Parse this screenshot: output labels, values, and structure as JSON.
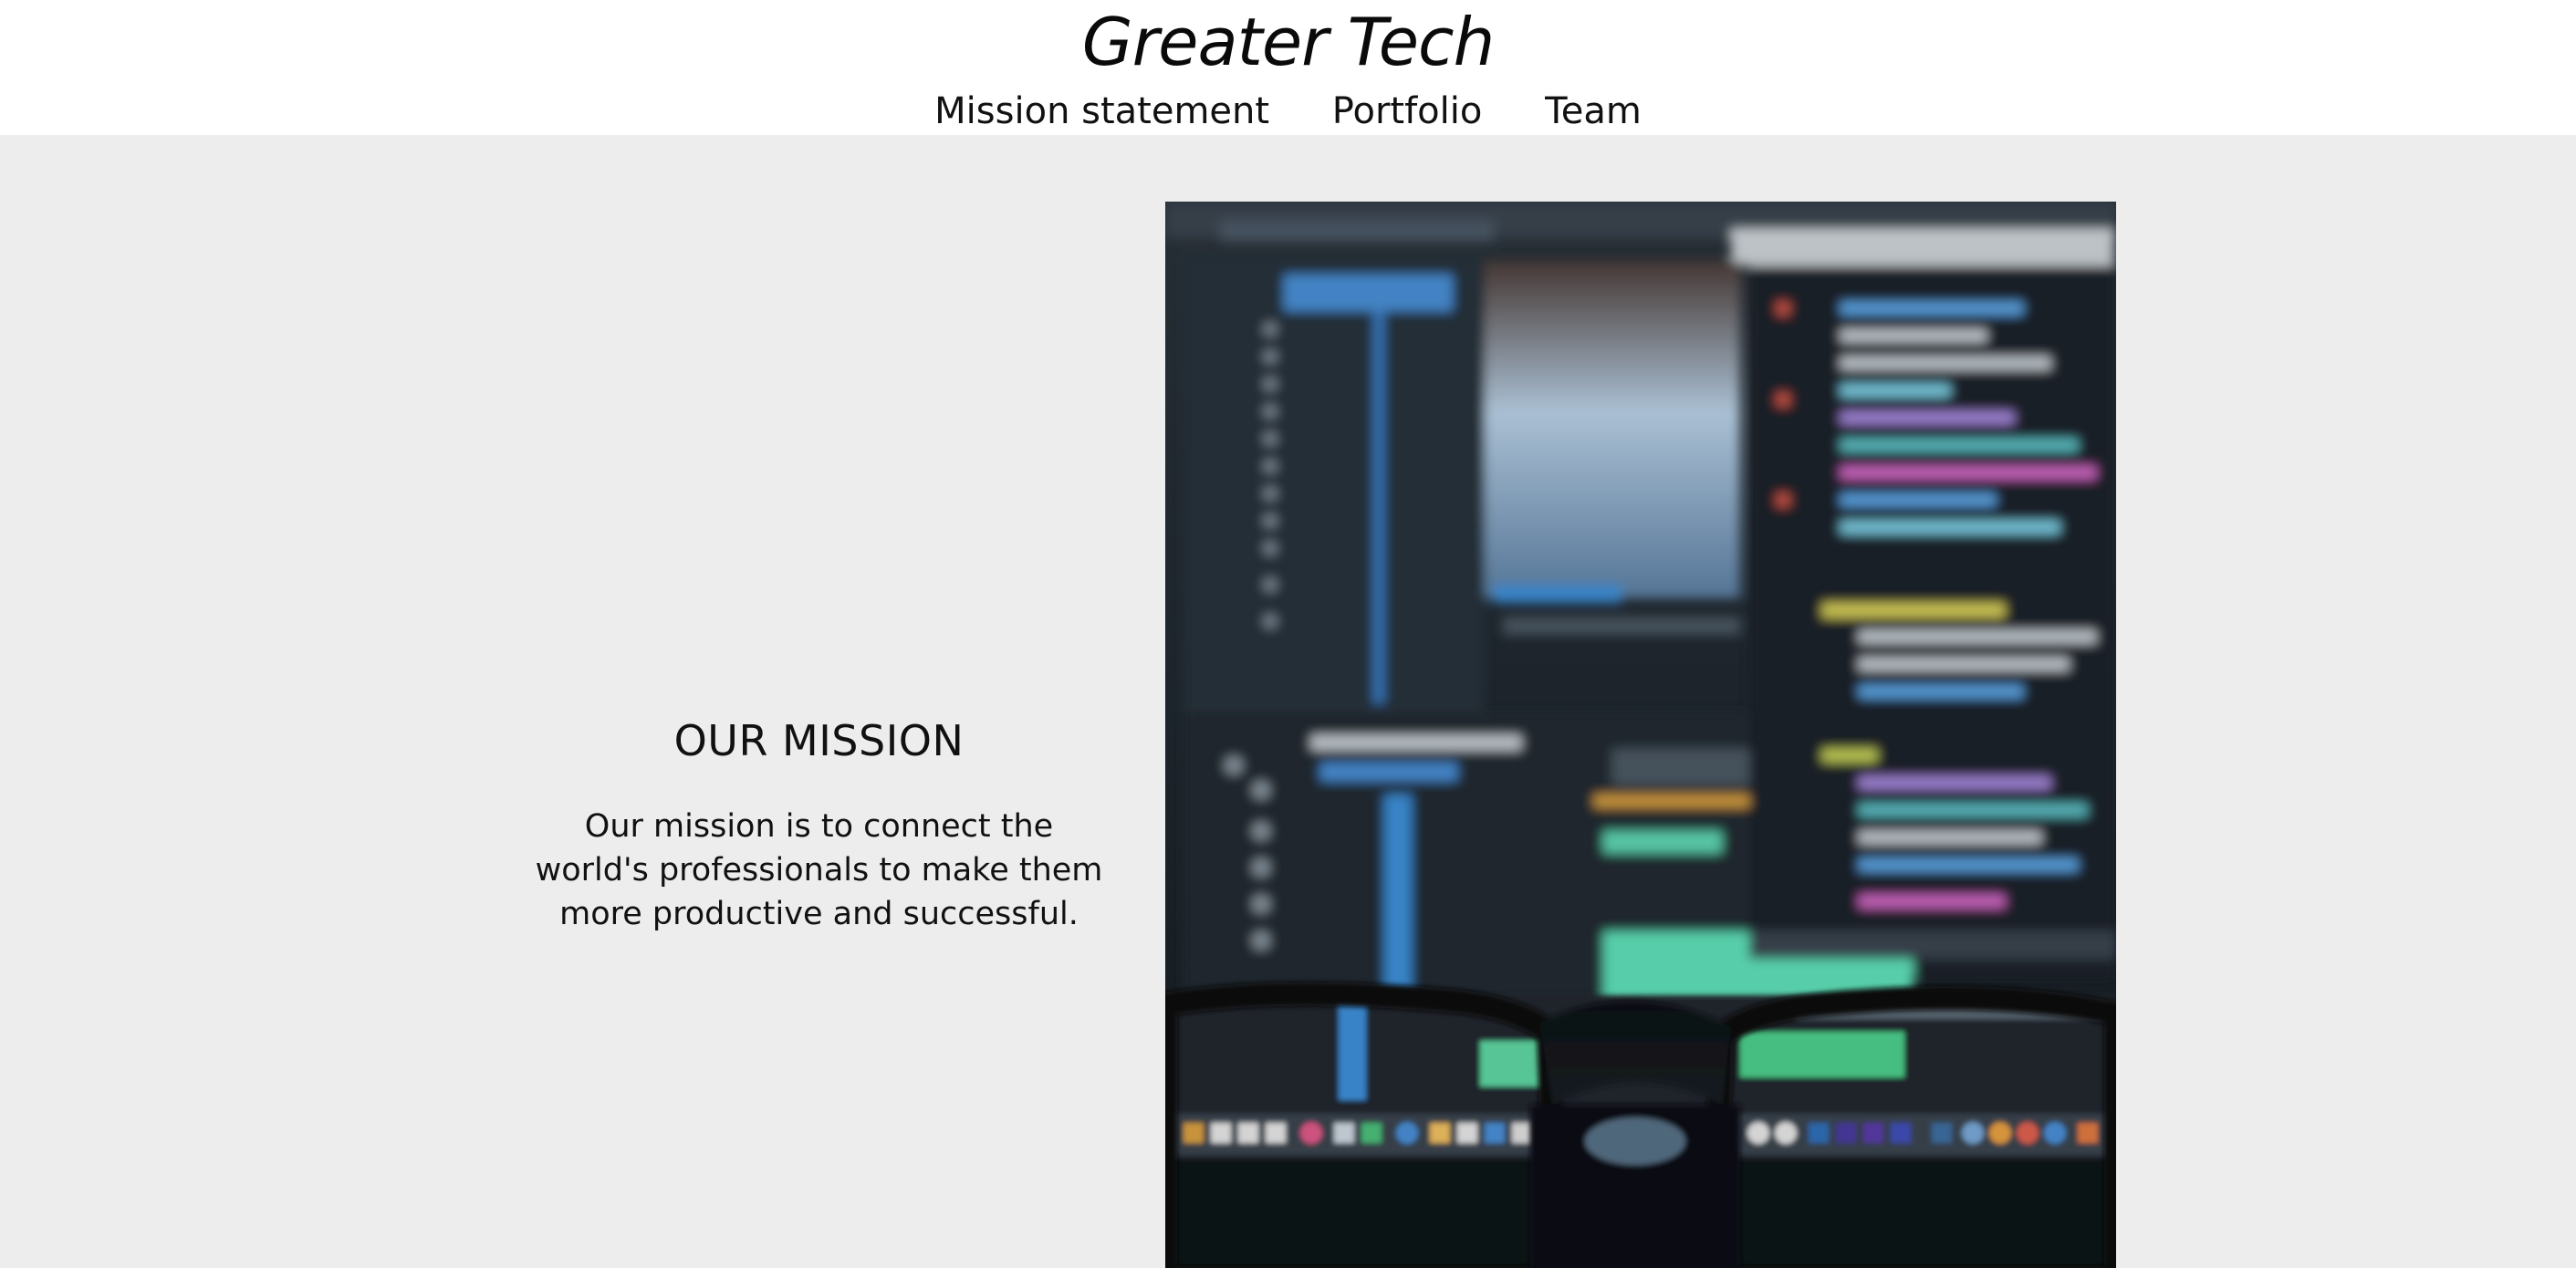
{
  "header": {
    "brand": "Greater Tech",
    "nav": [
      {
        "label": "Mission statement"
      },
      {
        "label": "Portfolio"
      },
      {
        "label": "Team"
      }
    ]
  },
  "mission": {
    "heading": "OUR MISSION",
    "body": "Our mission is to connect the world's professionals to make them more productive and successful."
  },
  "hero_image": {
    "description_icon": "blurred-code-screen-with-eyeglasses-photo"
  },
  "colors": {
    "page_bg": "#ededed",
    "header_bg": "#ffffff",
    "text": "#111111"
  }
}
